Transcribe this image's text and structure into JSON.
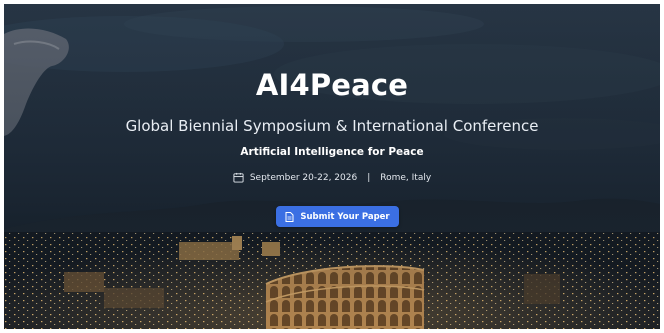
{
  "hero": {
    "title": "AI4Peace",
    "subtitle": "Global Biennial Symposium & International Conference",
    "tagline": "Artificial Intelligence for Peace",
    "date": "September 20-22, 2026",
    "separator": "|",
    "location": "Rome, Italy",
    "cta_label": "Submit Your Paper"
  },
  "icons": {
    "calendar": "calendar-icon",
    "document": "document-icon"
  },
  "colors": {
    "accent": "#3b6fe3",
    "sky": "#2a3a4a",
    "text": "#ffffff"
  }
}
